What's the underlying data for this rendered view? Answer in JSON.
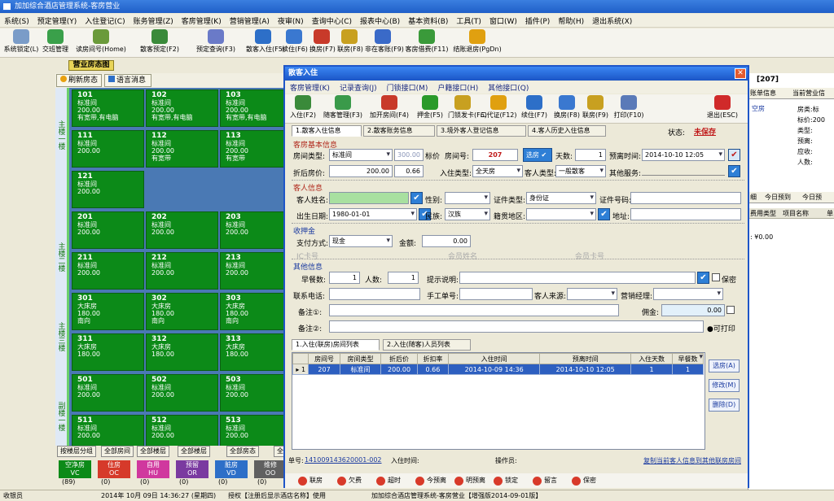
{
  "app": {
    "title": "加加综合酒店管理系统-客房营业"
  },
  "menu": [
    "系统(S)",
    "预定管理(Y)",
    "入住登记(C)",
    "账务管理(Z)",
    "客房管理(K)",
    "营销管理(A)",
    "夜审(N)",
    "查询中心(C)",
    "报表中心(B)",
    "基本资料(B)",
    "工具(T)",
    "窗口(W)",
    "插件(P)",
    "帮助(H)",
    "退出系统(X)"
  ],
  "toolbar": [
    "系统锁定(L)",
    "交班管理",
    "读房间号(Home)",
    "散客预定(F2)",
    "预定查询(F3)",
    "散客入住(F5)",
    "续住(F6)",
    "换房(F7)",
    "联房(F8)",
    "非在客账(F9)",
    "客房借费(F11)",
    "结账退房(PgDn)"
  ],
  "room_tab": "营业房态图",
  "left_buttons": [
    "刷新房态",
    "语言消息"
  ],
  "rooms": [
    {
      "no": "101",
      "type": "标准间",
      "price": "200.00",
      "note": "有宽带,有电脑"
    },
    {
      "no": "102",
      "type": "标准间",
      "price": "200.00",
      "note": "有宽带,有电脑"
    },
    {
      "no": "103",
      "type": "标准间",
      "price": "200.00",
      "note": "有宽带,有电脑"
    },
    {
      "no": "111",
      "type": "标准间",
      "price": "200.00",
      "note": ""
    },
    {
      "no": "112",
      "type": "标准间",
      "price": "200.00",
      "note": "有宽带"
    },
    {
      "no": "113",
      "type": "标准间",
      "price": "200.00",
      "note": "有宽带"
    },
    {
      "no": "121",
      "type": "标准间",
      "price": "200.00",
      "note": ""
    },
    {
      "no": "201",
      "type": "标准间",
      "price": "200.00",
      "note": ""
    },
    {
      "no": "202",
      "type": "标准间",
      "price": "200.00",
      "note": ""
    },
    {
      "no": "203",
      "type": "标准间",
      "price": "200.00",
      "note": ""
    },
    {
      "no": "211",
      "type": "标准间",
      "price": "200.00",
      "note": ""
    },
    {
      "no": "212",
      "type": "标准间",
      "price": "200.00",
      "note": ""
    },
    {
      "no": "213",
      "type": "标准间",
      "price": "200.00",
      "note": ""
    },
    {
      "no": "301",
      "type": "大床房",
      "price": "180.00",
      "note": "南向"
    },
    {
      "no": "302",
      "type": "大床房",
      "price": "180.00",
      "note": "南向"
    },
    {
      "no": "303",
      "type": "大床房",
      "price": "180.00",
      "note": "南向"
    },
    {
      "no": "311",
      "type": "大床房",
      "price": "180.00",
      "note": ""
    },
    {
      "no": "312",
      "type": "大床房",
      "price": "180.00",
      "note": ""
    },
    {
      "no": "313",
      "type": "大床房",
      "price": "180.00",
      "note": ""
    },
    {
      "no": "501",
      "type": "标准间",
      "price": "200.00",
      "note": ""
    },
    {
      "no": "502",
      "type": "标准间",
      "price": "200.00",
      "note": ""
    },
    {
      "no": "503",
      "type": "标准间",
      "price": "200.00",
      "note": ""
    },
    {
      "no": "511",
      "type": "标准间",
      "price": "200.00",
      "note": ""
    },
    {
      "no": "512",
      "type": "标准间",
      "price": "200.00",
      "note": ""
    },
    {
      "no": "513",
      "type": "标准间",
      "price": "200.00",
      "note": ""
    }
  ],
  "floors": [
    "主楼一楼",
    "主楼二楼",
    "主楼三楼",
    "副楼一楼"
  ],
  "bottom_tabs": [
    "按楼层分组",
    "全部房间",
    "全部楼层",
    "全部楼层",
    "全部房态",
    "全"
  ],
  "legend": [
    {
      "label": "空净房",
      "code": "VC",
      "color": "#0c8a18"
    },
    {
      "label": "住房",
      "code": "OC",
      "color": "#d63a2a"
    },
    {
      "label": "自用",
      "code": "HU",
      "color": "#d0389e"
    },
    {
      "label": "预留",
      "code": "OR",
      "color": "#7a3aa0"
    },
    {
      "label": "脏房",
      "code": "VD",
      "color": "#2d6fc8"
    },
    {
      "label": "维修",
      "code": "OO",
      "color": "#606060"
    }
  ],
  "legend_counts": [
    "(89)",
    "(0)",
    "(0)",
    "(0)",
    "(0)",
    "(0)"
  ],
  "status": {
    "user": "收银员",
    "datetime": "2014年 10月 09日 14:36:27 (星期四)",
    "license": "授权【注册后显示酒店名称】使用",
    "window": "加加综合酒店管理系统-客房营业【增强版2014-09-01版】"
  },
  "right_pane": {
    "header": "[207]",
    "tabs": [
      "账单信息",
      "当前营业信"
    ],
    "labels": [
      "房类:",
      "标价:",
      "类型:",
      "预离:",
      "应收:",
      "人数:"
    ],
    "vals": [
      "标",
      "200",
      "",
      "",
      "",
      ""
    ],
    "status": "空房",
    "tabs2": [
      "细",
      "今日预到",
      "今日预"
    ],
    "cols": [
      "费用类型",
      "项目名称",
      "单"
    ],
    "amount": "¥0.00"
  },
  "dialog": {
    "title": "散客入住",
    "menu": [
      "客房管理(K)",
      "记录查询(J)",
      "门锁接口(M)",
      "户籍接口(H)",
      "其他接口(Q)"
    ],
    "toolbar": [
      "入住(F2)",
      "随客管理(F3)",
      "加开房间(F4)",
      "押金(F5)",
      "门锁发卡(F6)",
      "二代证(F12)",
      "续住(F7)",
      "换房(F8)",
      "联房(F9)",
      "打印(F10)",
      "退出(ESC)"
    ],
    "tabs": [
      "1.散客入住信息",
      "2.散客账务信息",
      "3.境外客人登记信息",
      "4.客人历史入住信息"
    ],
    "status_label": "状态:",
    "status_value": "未保存",
    "sec_room": "客房基本信息",
    "room_type_label": "房间类型:",
    "room_type": "标准间",
    "price_hint": "300.00",
    "list_price_label": "标价",
    "room_no_label": "房间号:",
    "room_no": "207",
    "select_room_btn": "选房",
    "days_label": "天数:",
    "days": "1",
    "leave_label": "预离时间:",
    "leave_time": "2014-10-10 12:05",
    "discount_label": "折后房价:",
    "discount_price": "200.00",
    "discount_rate": "0.66",
    "checkin_type_label": "入住类型:",
    "checkin_type": "全天房",
    "guest_type_label": "客人类型:",
    "guest_type": "一般散客",
    "other_label": "其他服务:",
    "sec_guest": "客人信息",
    "name_label": "客人姓名:",
    "gender_label": "性别:",
    "idtype_label": "证件类型:",
    "idtype": "身份证",
    "idno_label": "证件号码:",
    "birth_label": "出生日期:",
    "birth": "1980-01-01",
    "nation_label": "民族:",
    "nation": "汉族",
    "origin_label": "籍贯地区:",
    "address_label": "地址:",
    "sec_deposit": "收押金",
    "pay_label": "支付方式:",
    "pay": "现金",
    "amount_label": "金额:",
    "amount": "0.00",
    "member_card_label": "会员卡号",
    "member_name_label": "会员姓名",
    "member_no_label": "会员卡号",
    "card_prefix": "IC卡号",
    "sec_other": "其他信息",
    "breakfast_label": "早餐数:",
    "breakfast": "1",
    "persons_label": "人数:",
    "persons": "1",
    "tips_label": "提示说明:",
    "secret_label": "保密",
    "phone_label": "联系电话:",
    "manual_label": "手工单号:",
    "source_label": "客人来源:",
    "manager_label": "营销经理:",
    "remark1_label": "备注①:",
    "commission_label": "佣金:",
    "commission": "0.00",
    "remark2_label": "备注②:",
    "print_label": "●可打印",
    "subtabs": [
      "1.入住(联房)房间列表",
      "2.入住(随客)人员列表"
    ],
    "table": {
      "headers": [
        "房间号",
        "房间类型",
        "折后价",
        "折扣率",
        "入住时间",
        "预离时间",
        "入住天数",
        "早餐数"
      ],
      "rows": [
        [
          "207",
          "标准间",
          "200.00",
          "0.66",
          "2014-10-09 14:36",
          "2014-10-10 12:05",
          "1",
          "1"
        ]
      ],
      "row_no": "1"
    },
    "side_buttons": [
      "选房(A)",
      "修改(M)",
      "删除(D)"
    ],
    "foot_no_label": "单号:",
    "foot_no": "141009143620001-002",
    "foot_time_label": "入住时间:",
    "foot_op_label": "操作员:",
    "foot_link": "复制当前客人信息到其他联房房间",
    "bottom": [
      "联房",
      "欠费",
      "超时",
      "今预离",
      "明预离",
      "锁定",
      "留言",
      "保密"
    ]
  },
  "colors": {
    "room_green": "#0c8a18",
    "title_blue": "#1f5fc8",
    "accent_red": "#b0261a"
  }
}
